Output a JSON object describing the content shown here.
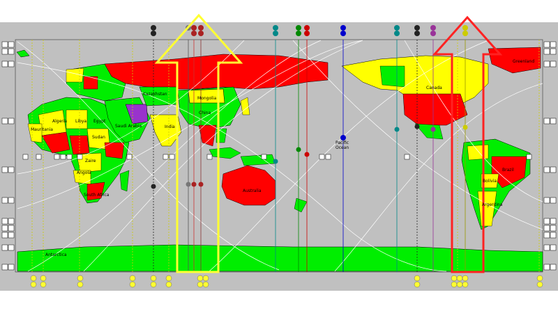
{
  "map": {
    "country_labels": [
      {
        "key": "mongolia",
        "text": "Mongolia"
      },
      {
        "key": "kazakhstan",
        "text": "Kazakhstan"
      },
      {
        "key": "china",
        "text": "China"
      },
      {
        "key": "india",
        "text": "India"
      },
      {
        "key": "saudi",
        "text": "Saudi Arabia"
      },
      {
        "key": "algeria",
        "text": "Algeria"
      },
      {
        "key": "libya",
        "text": "Libya"
      },
      {
        "key": "egypt",
        "text": "Egypt"
      },
      {
        "key": "mauritania",
        "text": "Mauritania"
      },
      {
        "key": "sudan",
        "text": "Sudan"
      },
      {
        "key": "zaire",
        "text": "Zaire"
      },
      {
        "key": "angola",
        "text": "Angola"
      },
      {
        "key": "south_africa",
        "text": "South Africa"
      },
      {
        "key": "australia",
        "text": "Australia"
      },
      {
        "key": "antarctica",
        "text": "Antarctica"
      },
      {
        "key": "canada",
        "text": "Canada"
      },
      {
        "key": "greenland",
        "text": "Greenland"
      },
      {
        "key": "brazil",
        "text": "Brazil"
      },
      {
        "key": "argentina",
        "text": "Argentina"
      },
      {
        "key": "bolivia",
        "text": "Bolivia"
      },
      {
        "key": "pacific",
        "text": "Pacific\nOcean"
      }
    ]
  },
  "colors": {
    "background": "#c0c0c0",
    "ocean": "#c0c0c0",
    "country_red": "#ff0000",
    "country_green": "#00ee00",
    "country_yellow": "#ffff00",
    "country_purple": "#9933cc",
    "yellow_highlight": "#ffff33",
    "red_highlight": "#ff2222"
  }
}
